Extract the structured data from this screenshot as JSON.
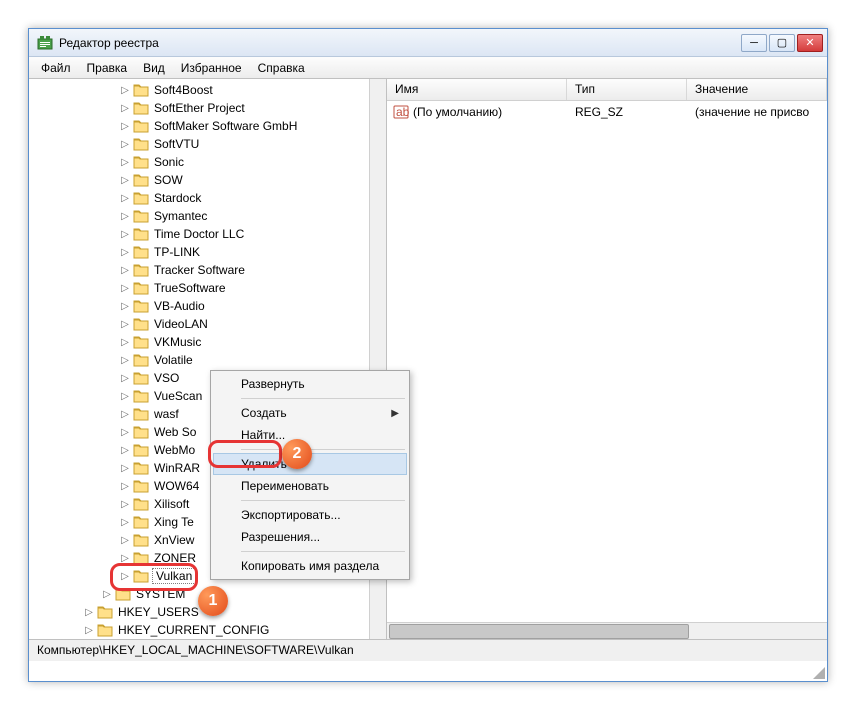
{
  "window": {
    "title": "Редактор реестра"
  },
  "menubar": {
    "file": "Файл",
    "edit": "Правка",
    "view": "Вид",
    "favorites": "Избранное",
    "help": "Справка"
  },
  "tree": {
    "items": [
      {
        "label": "Soft4Boost",
        "indent": 90,
        "exp": "▷"
      },
      {
        "label": "SoftEther Project",
        "indent": 90,
        "exp": "▷"
      },
      {
        "label": "SoftMaker Software GmbH",
        "indent": 90,
        "exp": "▷"
      },
      {
        "label": "SoftVTU",
        "indent": 90,
        "exp": "▷"
      },
      {
        "label": "Sonic",
        "indent": 90,
        "exp": "▷"
      },
      {
        "label": "SOW",
        "indent": 90,
        "exp": "▷"
      },
      {
        "label": "Stardock",
        "indent": 90,
        "exp": "▷"
      },
      {
        "label": "Symantec",
        "indent": 90,
        "exp": "▷"
      },
      {
        "label": "Time Doctor LLC",
        "indent": 90,
        "exp": "▷"
      },
      {
        "label": "TP-LINK",
        "indent": 90,
        "exp": "▷"
      },
      {
        "label": "Tracker Software",
        "indent": 90,
        "exp": "▷"
      },
      {
        "label": "TrueSoftware",
        "indent": 90,
        "exp": "▷"
      },
      {
        "label": "VB-Audio",
        "indent": 90,
        "exp": "▷"
      },
      {
        "label": "VideoLAN",
        "indent": 90,
        "exp": "▷"
      },
      {
        "label": "VKMusic",
        "indent": 90,
        "exp": "▷"
      },
      {
        "label": "Volatile",
        "indent": 90,
        "exp": "▷"
      },
      {
        "label": "VSO",
        "indent": 90,
        "exp": "▷"
      },
      {
        "label": "VueScan",
        "indent": 90,
        "exp": "▷"
      },
      {
        "label": "wasf",
        "indent": 90,
        "exp": "▷"
      },
      {
        "label": "Web So",
        "indent": 90,
        "exp": "▷"
      },
      {
        "label": "WebMo",
        "indent": 90,
        "exp": "▷"
      },
      {
        "label": "WinRAR",
        "indent": 90,
        "exp": "▷"
      },
      {
        "label": "WOW64",
        "indent": 90,
        "exp": "▷"
      },
      {
        "label": "Xilisoft",
        "indent": 90,
        "exp": "▷"
      },
      {
        "label": "Xing Te",
        "indent": 90,
        "exp": "▷"
      },
      {
        "label": "XnView",
        "indent": 90,
        "exp": "▷"
      },
      {
        "label": "ZONER",
        "indent": 90,
        "exp": "▷"
      },
      {
        "label": "Vulkan",
        "indent": 90,
        "exp": "▷",
        "selected": true
      },
      {
        "label": "SYSTEM",
        "indent": 72,
        "exp": "▷"
      },
      {
        "label": "HKEY_USERS",
        "indent": 54,
        "exp": "▷"
      },
      {
        "label": "HKEY_CURRENT_CONFIG",
        "indent": 54,
        "exp": "▷"
      }
    ]
  },
  "list": {
    "columns": {
      "name": "Имя",
      "type": "Тип",
      "value": "Значение"
    },
    "widths": {
      "name": 180,
      "type": 120,
      "value": 140
    },
    "rows": [
      {
        "name": "(По умолчанию)",
        "type": "REG_SZ",
        "value": "(значение не присво"
      }
    ]
  },
  "context_menu": {
    "expand": "Развернуть",
    "create": "Создать",
    "find": "Найти...",
    "delete": "Удалить",
    "rename": "Переименовать",
    "export": "Экспортировать...",
    "permissions": "Разрешения...",
    "copy_key": "Копировать имя раздела"
  },
  "statusbar": {
    "path": "Компьютер\\HKEY_LOCAL_MACHINE\\SOFTWARE\\Vulkan"
  },
  "badges": {
    "one": "1",
    "two": "2"
  }
}
